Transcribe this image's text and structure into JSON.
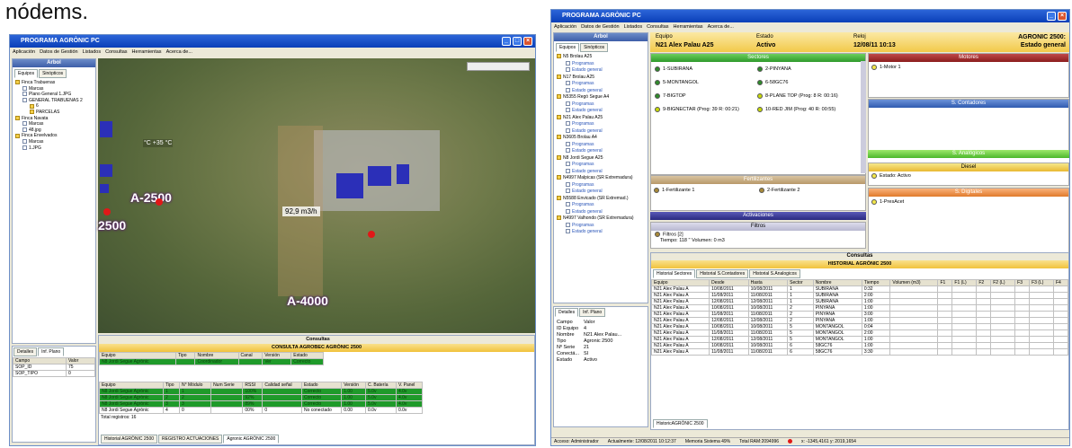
{
  "caption": "nódems.",
  "left": {
    "title": "PROGRAMA AGRÒNIC PC",
    "menu": [
      "Aplicación",
      "Datos de Gestión",
      "Listados",
      "Consultas",
      "Herramientas",
      "Acerca de..."
    ],
    "tree_title": "Arbol",
    "tree_tabs": [
      "Equipos",
      "Sinópticos"
    ],
    "tree": [
      "Finca Trabuenas",
      "Marcas",
      "Plano General 1.JPG",
      "GENERAL TRABUENAS 2",
      "6",
      "PARCELAS",
      "Finca Navata",
      "Marcas",
      "48.jpg",
      "Finca Envelvados",
      "Marcas",
      "1.JPG"
    ],
    "detail_tabs": [
      "Detalles",
      "Inf. Plano"
    ],
    "detail_head": [
      "Campo",
      "Valor"
    ],
    "detail_rows": [
      [
        "SOP_ID",
        "75"
      ],
      [
        "SOP_TIPO",
        "0"
      ]
    ],
    "map": {
      "temp": "°C  +35 °C",
      "lbl1": "A-2500",
      "lbl2": "2500",
      "lbl3": "A-4000",
      "flow": "92,9 m3/h"
    },
    "consultas": "Consultas",
    "consulta_title": "CONSULTA AGROBEC AGRÒNIC 2500",
    "t1_head": [
      "Equipo",
      "Tipo",
      "Nombre",
      "Canal",
      "Versión",
      "Estado"
    ],
    "t1_rows": [
      [
        "N8 Jordi Segue Agrònic",
        "",
        "Coordinador",
        "",
        "Ver",
        "Correcto"
      ]
    ],
    "t2_head": [
      "Equipo",
      "Tipo",
      "N° Módulo",
      "Num Serie",
      "RSSI",
      "Calidad señal",
      "Estado",
      "Versión",
      "C. Batería",
      "V. Panel"
    ],
    "t2_rows": [
      [
        "N8 Jordi Segue Agrònic",
        "1",
        "1",
        "",
        "100%",
        "",
        "Correcto",
        "1.00",
        "5.0v",
        "4.0v"
      ],
      [
        "N8 Jordi Segue Agrònic",
        "2",
        "2",
        "",
        "92%",
        "",
        "Correcto",
        "1.00",
        "5.0v",
        "4.0v"
      ],
      [
        "N8 Jordi Segue Agrònic",
        "3",
        "3",
        "",
        "89%",
        "",
        "Correcto",
        "1.00",
        "5.0v",
        "4.0v"
      ],
      [
        "N8 Jordi Segue Agrònic",
        "4",
        "0",
        "",
        "00%",
        "0",
        "No conectado",
        "0.00",
        "0.0v",
        "0.0v"
      ]
    ],
    "total": "Total registros: 16",
    "bottom_tabs": [
      "Historial AGRÒNIC 2500",
      "REGISTRO ACTUACIONES",
      "Agronic AGRÒNIC 2500"
    ]
  },
  "right": {
    "title": "PROGRAMA AGRÒNIC PC",
    "menu": [
      "Aplicación",
      "Datos de Gestión",
      "Listados",
      "Consultas",
      "Herramientas",
      "Acerca de..."
    ],
    "tree_title": "Arbol",
    "tree_tabs": [
      "Equipos",
      "Sinópticos"
    ],
    "tree": [
      "N5 Brolau A25",
      "Programas",
      "Estado general",
      "N17 Brolau A25",
      "Programas",
      "Estado general",
      "N5355 Regó Segue A4",
      "Programas",
      "Estado general",
      "N21 Alex Palau A25",
      "Programas",
      "Estado general",
      "N3605 Brolau A4",
      "Programas",
      "Estado general",
      "N8 Jordi Segue A25",
      "Programas",
      "Estado general",
      "N4997 Malpicas (SR Extremadura)",
      "Programas",
      "Estado general",
      "N5588 Envicado (SR Extremad.)",
      "Programas",
      "Estado general",
      "N4997 Valhondo (SR Extremadura)",
      "Programas",
      "Estado general"
    ],
    "detail_tabs": [
      "Detalles",
      "Inf. Plano"
    ],
    "detail_rows": [
      [
        "Campo",
        "Valor"
      ],
      [
        "ID Equipo",
        "4"
      ],
      [
        "Nombre",
        "N21 Alex Palau..."
      ],
      [
        "Tipo",
        "Agronic 2500"
      ],
      [
        "Nº Serie",
        "21"
      ],
      [
        "Conectá...",
        "SI"
      ],
      [
        "Estado",
        "Activo"
      ]
    ],
    "hdr": {
      "equipo_lbl": "Equipo",
      "equipo": "N21 Alex Palau A25",
      "estado_lbl": "Estado",
      "estado": "Activo",
      "reloj_lbl": "Reloj",
      "reloj": "12/08/11 10:13",
      "model": "AGRONIC 2500:",
      "model_sub": "Estado general"
    },
    "sectores_title": "Sectores",
    "sectores": [
      [
        "1-SUBIRANA",
        "green"
      ],
      [
        "2-PINYANA",
        "green"
      ],
      [
        "5-MONTANGOL",
        "green"
      ],
      [
        "6-58GC76",
        "green"
      ],
      [
        "7-BIGTOP",
        "green"
      ],
      [
        "8-PLANE TOP (Prog: 8 R: 00:16)",
        "#c6d80a"
      ],
      [
        "9-BIGNECTAR (Prog: 39 R: 00:21)",
        "#c6d80a"
      ],
      [
        "10-RED JIM (Prog: 40 R: 00:55)",
        "#c6d80a"
      ]
    ],
    "motores_title": "Motores",
    "motores": [
      "1-Motor 1"
    ],
    "contadores_title": "S. Contadores",
    "analogicos_title": "S. Analógicos",
    "diesel_title": "Diesel",
    "diesel": [
      "Estado: Activo"
    ],
    "digitales_title": "S. Digitales",
    "digitales": [
      "1-PresAcet"
    ],
    "fert_title": "Fertilizantes",
    "fert": [
      "1-Fertilizante 1",
      "2-Fertilizante 2"
    ],
    "activ_title": "Activaciones",
    "filtros_title": "Filtros",
    "filtros": [
      "Filtros [2]",
      "Tiempo: 118 ''   Volumen: 0 m3"
    ],
    "consultas": "Consultas",
    "hist_title": "HISTORIAL AGRÒNIC 2500",
    "hist_tabs": [
      "Historial Sectores",
      "Historial S.Contadores",
      "Historial S.Analogicos"
    ],
    "hist_head": [
      "Equipo",
      "Desde",
      "Hasta",
      "Sector",
      "Nombre",
      "Tiempo",
      "Volumen (m3)",
      "F1",
      "F1 (L)",
      "F2",
      "F2 (L)",
      "F3",
      "F3 (L)",
      "F4"
    ],
    "hist_rows": [
      [
        "N21 Alex Palau A",
        "10/08/2011",
        "10/08/2011",
        "1",
        "SUBIRANA",
        "0:32"
      ],
      [
        "N21 Alex Palau A",
        "11/08/2011",
        "11/08/2011",
        "1",
        "SUBIRANA",
        "2:00"
      ],
      [
        "N21 Alex Palau A",
        "12/08/2011",
        "12/08/2011",
        "1",
        "SUBIRANA",
        "1:00"
      ],
      [
        "N21 Alex Palau A",
        "10/08/2011",
        "10/08/2011",
        "2",
        "PINYANA",
        "1:00"
      ],
      [
        "N21 Alex Palau A",
        "11/08/2011",
        "11/08/2011",
        "2",
        "PINYANA",
        "3:00"
      ],
      [
        "N21 Alex Palau A",
        "12/08/2011",
        "12/08/2011",
        "2",
        "PINYANA",
        "1:00"
      ],
      [
        "N21 Alex Palau A",
        "10/08/2011",
        "10/08/2011",
        "5",
        "MONTANGOL",
        "0:04"
      ],
      [
        "N21 Alex Palau A",
        "11/08/2011",
        "11/08/2011",
        "5",
        "MONTANGOL",
        "2:00"
      ],
      [
        "N21 Alex Palau A",
        "12/08/2011",
        "12/08/2011",
        "5",
        "MONTANGOL",
        "1:00"
      ],
      [
        "N21 Alex Palau A",
        "10/08/2011",
        "10/08/2011",
        "6",
        "58GC76",
        "1:00"
      ],
      [
        "N21 Alex Palau A",
        "11/08/2011",
        "11/08/2011",
        "6",
        "58GC76",
        "3:30"
      ]
    ],
    "bottom_tab": "HistoricAGRÒNIC 2500",
    "status": [
      "Acceso: Administrador",
      "Actualmente: 12/08/2011 10:12:37",
      "Memoria Sistema 49%",
      "Total RAM:2094996",
      "x: -1345,4161  y: 2019,1654"
    ]
  }
}
